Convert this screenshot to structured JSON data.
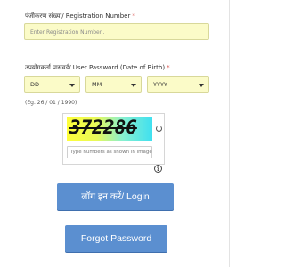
{
  "registration": {
    "label": "पंजीकरण संख्या/ Registration Number",
    "required_mark": "*",
    "placeholder": "Enter Registration Number.."
  },
  "password": {
    "label": "उपयोगकर्ता पासवर्ड/ User Password (Date of Birth)",
    "required_mark": "*",
    "day": "DD",
    "month": "MM",
    "year": "YYYY",
    "example": "(Eg. 26 / 01 / 1990)"
  },
  "captcha": {
    "code": "372286",
    "input_placeholder": "Type numbers as shown in image",
    "help_symbol": "?"
  },
  "buttons": {
    "login": "लॉग इन करें/ Login",
    "forgot": "Forgot Password"
  },
  "colors": {
    "button": "#5b8fd0",
    "input_bg": "#fbfbc8",
    "required": "#d9534f"
  }
}
